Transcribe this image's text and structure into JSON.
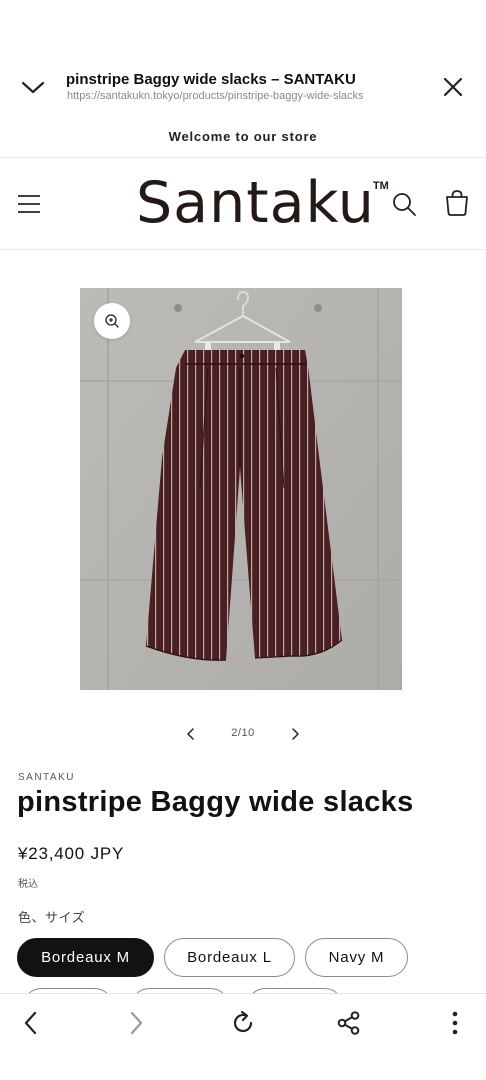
{
  "browser": {
    "page_title": "pinstripe Baggy wide slacks – SANTAKU",
    "url": "https://santakukn.tokyo/products/pinstripe-baggy-wide-slacks"
  },
  "announcement": "Welcome to our store",
  "header": {
    "logo_text": "Santaku",
    "logo_mark": "TM"
  },
  "gallery": {
    "counter": "2/10"
  },
  "product": {
    "vendor": "SANTAKU",
    "title": "pinstripe Baggy wide slacks",
    "price": "¥23,400 JPY",
    "tax_note": "税込",
    "option_label": "色、サイズ",
    "variants": [
      {
        "label": "Bordeaux M",
        "selected": true
      },
      {
        "label": "Bordeaux L",
        "selected": false
      },
      {
        "label": "Navy M",
        "selected": false
      }
    ]
  },
  "colors": {
    "accent": "#121212",
    "fabric": "#4a1f22",
    "stripe": "#cfc6c2",
    "wall": "#b9b7b3"
  },
  "icons": {
    "browser_collapse": "chevron-down-icon",
    "browser_close": "close-icon",
    "menu": "hamburger-icon",
    "search": "search-icon",
    "cart": "cart-icon",
    "zoom": "zoom-in-icon",
    "prev": "chevron-left-icon",
    "next": "chevron-right-icon",
    "nav_back": "arrow-left-icon",
    "nav_forward": "arrow-right-icon",
    "reload": "reload-icon",
    "share": "share-icon",
    "more": "more-vertical-icon"
  }
}
